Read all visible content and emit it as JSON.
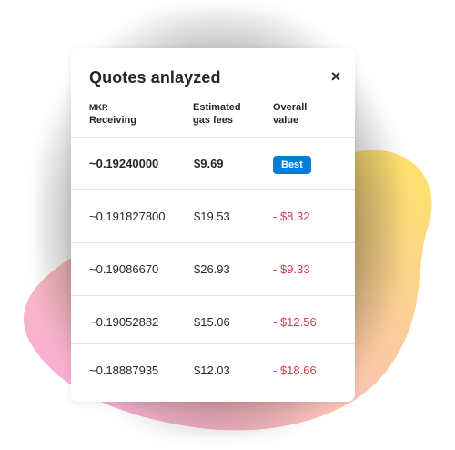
{
  "colors": {
    "accent": "#037dd6",
    "negative": "#d73a49",
    "text": "#24272a",
    "blob_yellow": "#ffe466",
    "blob_pink": "#f6a6e0"
  },
  "modal": {
    "title": "Quotes anlayzed",
    "close_icon": "close-icon",
    "close_label": "×"
  },
  "columns": {
    "receiving_token": "MKR",
    "receiving_label": "Receiving",
    "gas_label_1": "Estimated",
    "gas_label_2": "gas fees",
    "value_label_1": "Overall",
    "value_label_2": "value"
  },
  "rows": [
    {
      "receiving": "~0.19240000",
      "gas": "$9.69",
      "value": "Best"
    },
    {
      "receiving": "~0.191827800",
      "gas": "$19.53",
      "value": "- $8.32"
    },
    {
      "receiving": "~0.19086670",
      "gas": "$26.93",
      "value": "- $9.33"
    },
    {
      "receiving": "~0.19052882",
      "gas": "$15.06",
      "value": "- $12.56"
    },
    {
      "receiving": "~0.18887935",
      "gas": "$12.03",
      "value": "- $18.66"
    }
  ]
}
